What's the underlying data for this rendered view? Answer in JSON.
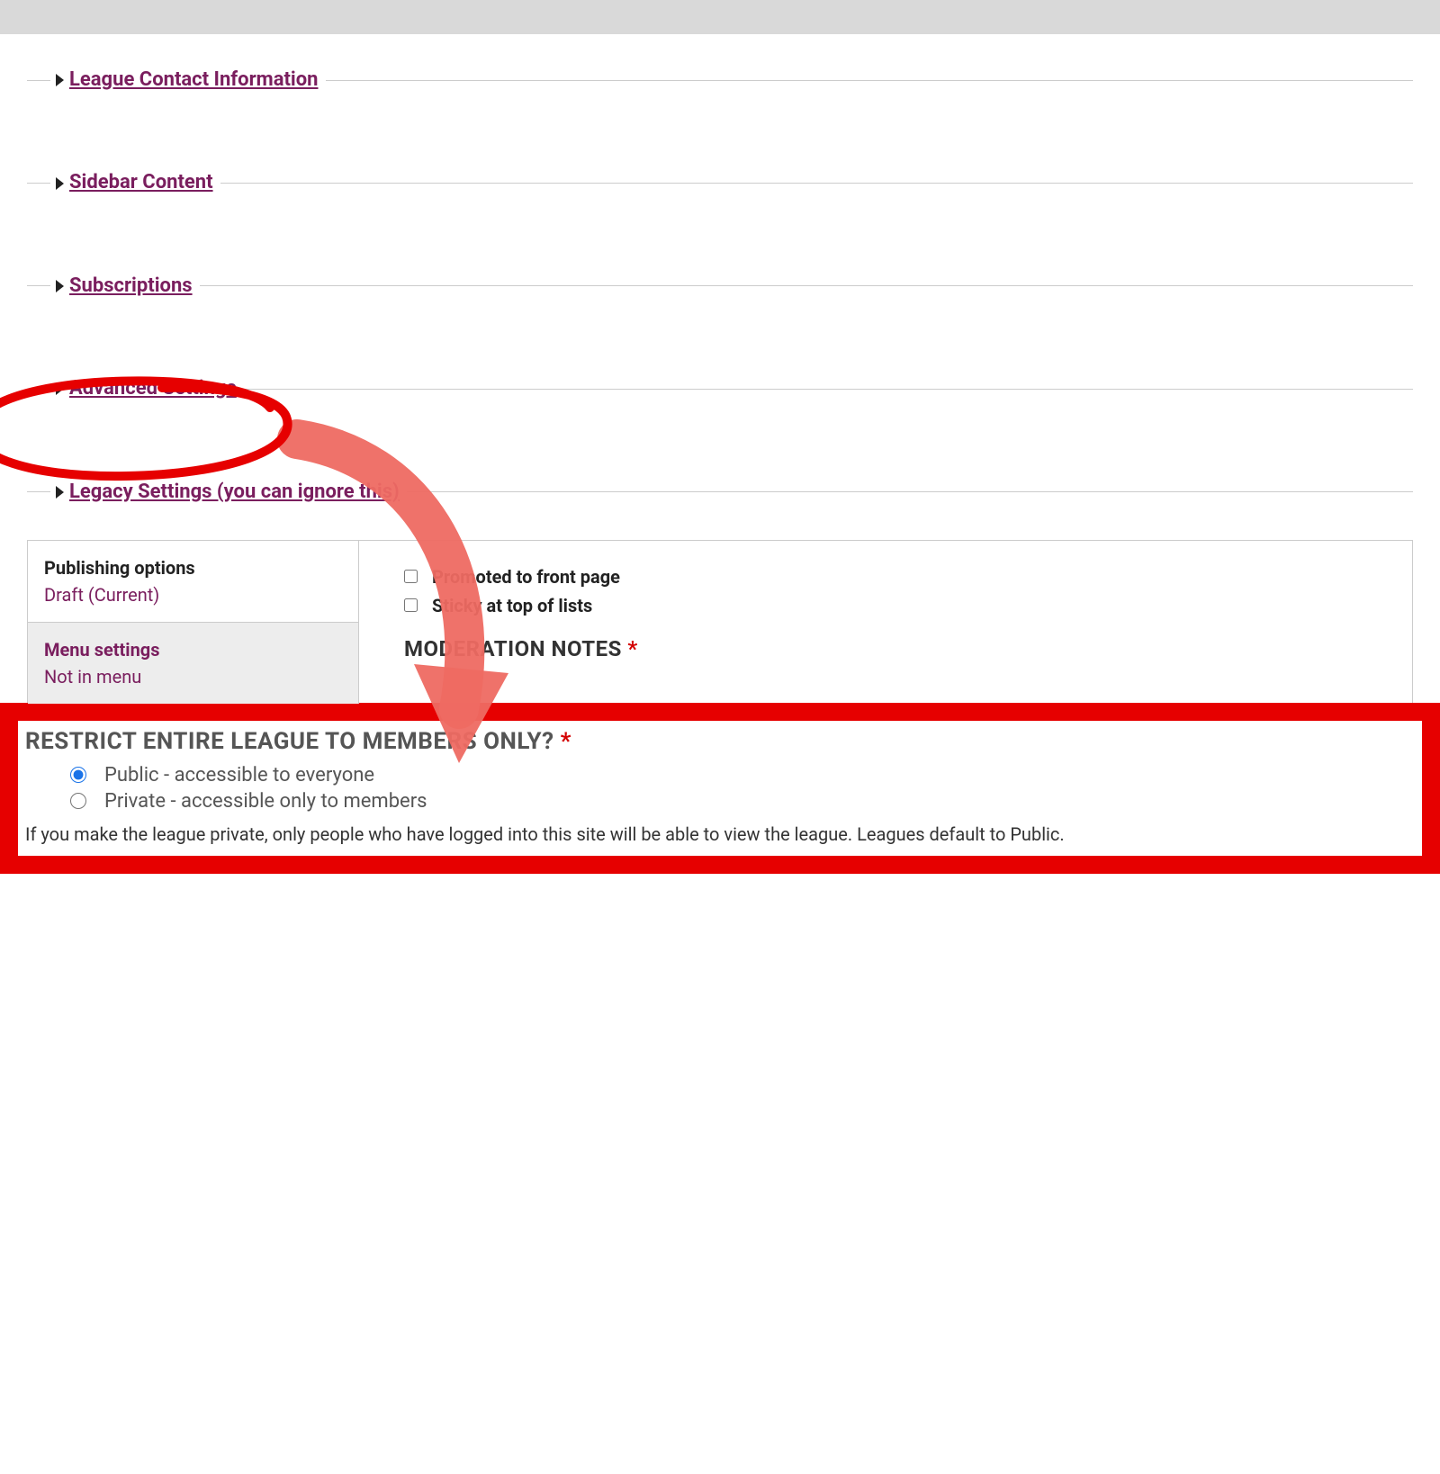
{
  "sections": {
    "league_contact": "League Contact Information",
    "sidebar_content": "Sidebar Content",
    "subscriptions": "Subscriptions",
    "advanced_settings": "Advanced Settings",
    "legacy_settings": "Legacy Settings (you can ignore this)"
  },
  "vtabs": {
    "publishing": {
      "title": "Publishing options",
      "sub": "Draft (Current)"
    },
    "menu": {
      "title": "Menu settings",
      "sub": "Not in menu"
    },
    "pane": {
      "promoted_label": "Promoted to front page",
      "sticky_label": "Sticky at top of lists",
      "moderation_heading": "MODERATION NOTES"
    }
  },
  "restrict": {
    "heading": "RESTRICT ENTIRE LEAGUE TO MEMBERS ONLY?",
    "public_label": "Public - accessible to everyone",
    "private_label": "Private - accessible only to members",
    "help": "If you make the league private, only people who have logged into this site will be able to view the league. Leagues default to Public."
  },
  "required_marker": "*"
}
